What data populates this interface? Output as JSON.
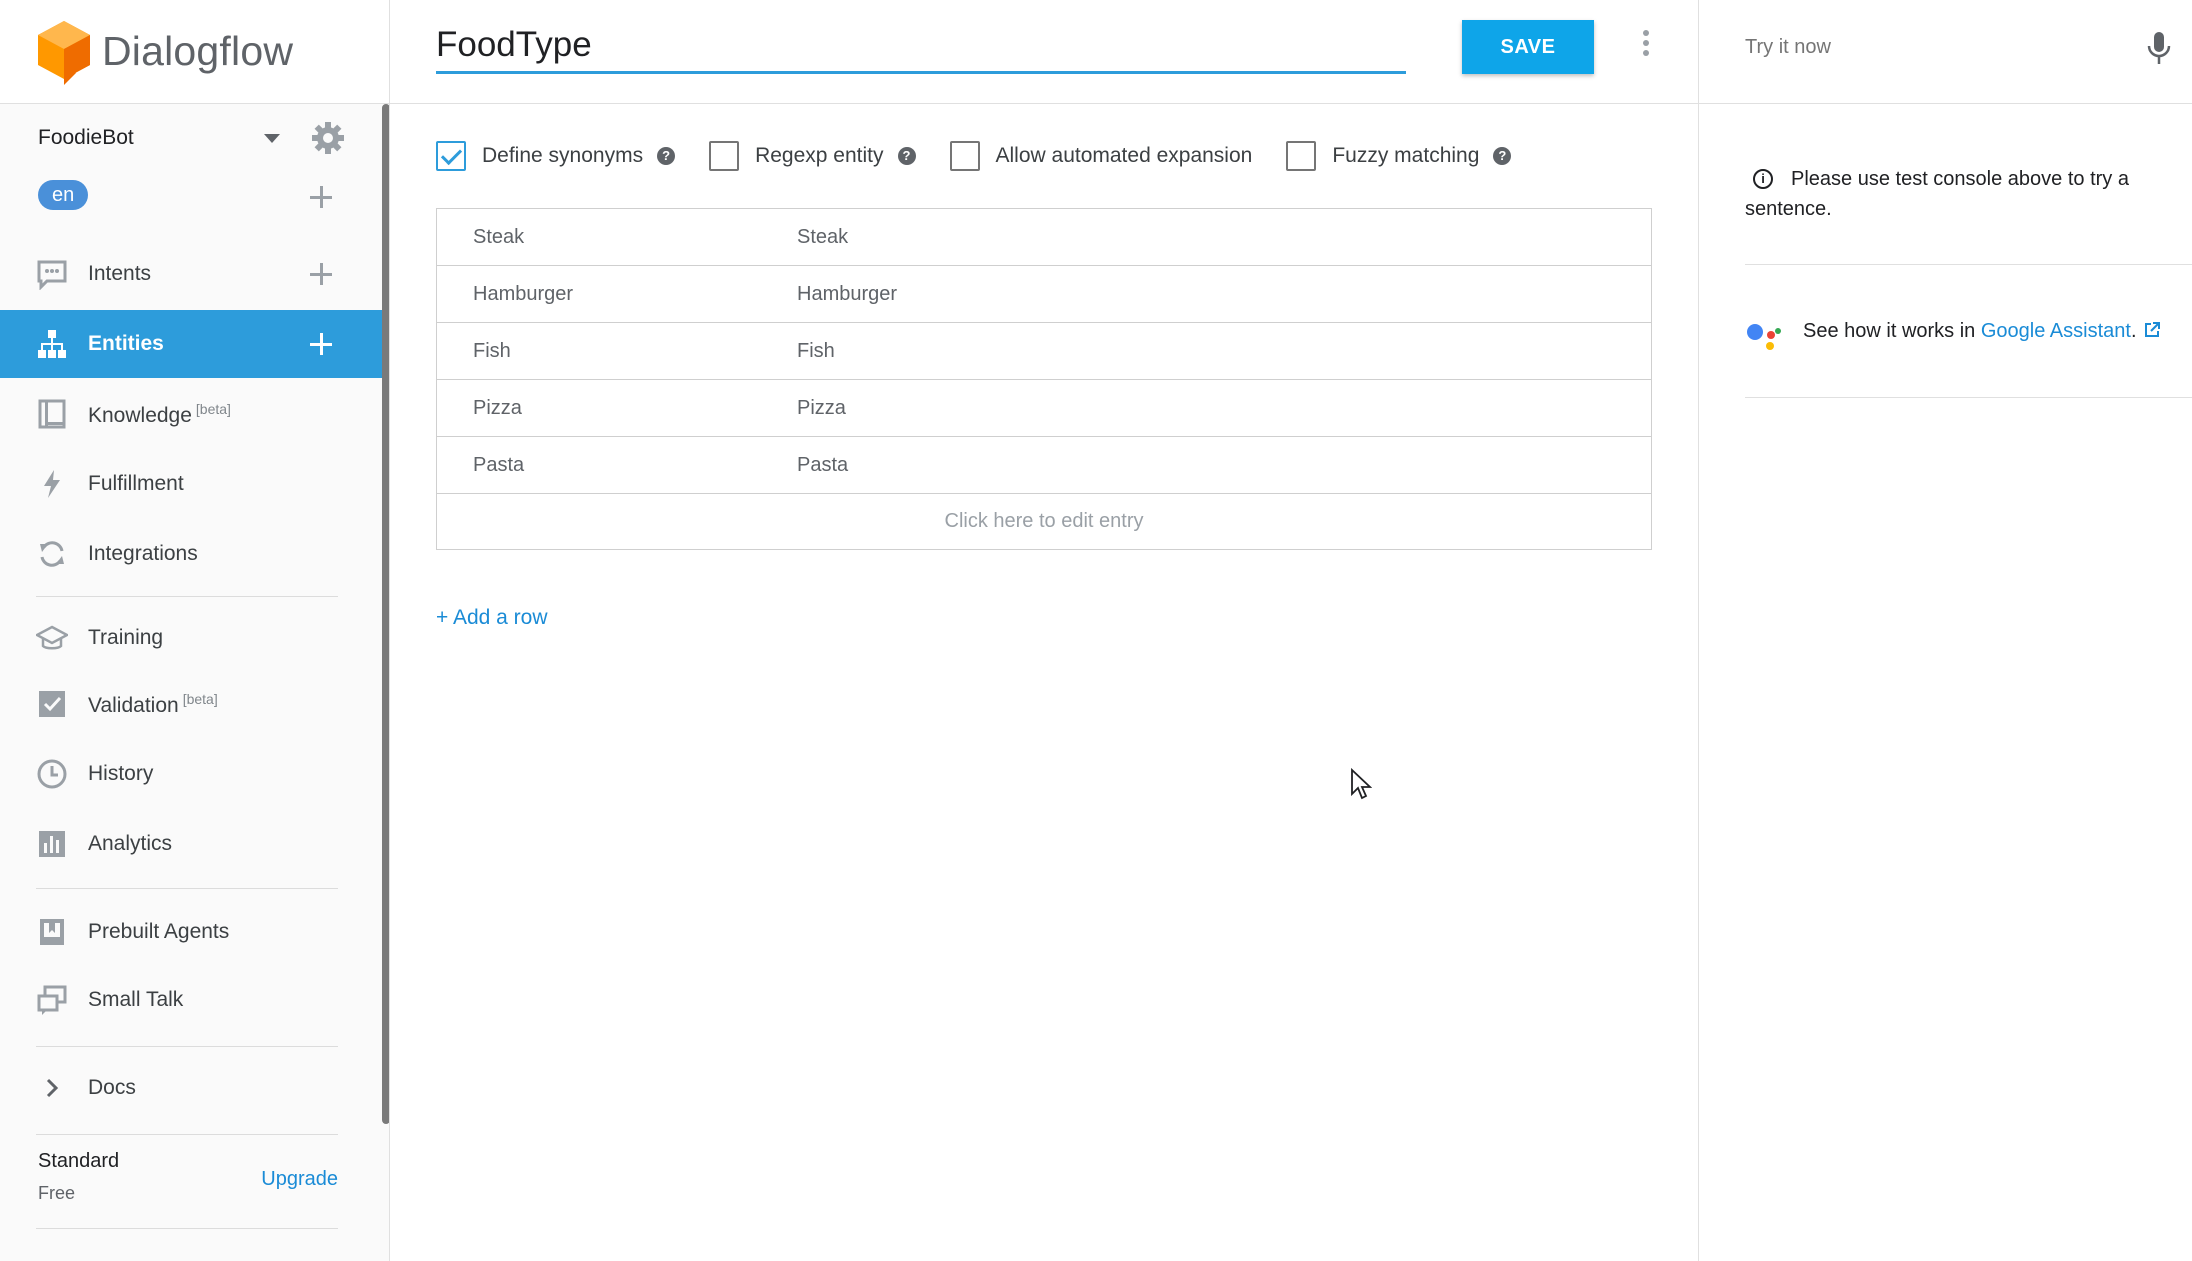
{
  "app": {
    "name": "Dialogflow"
  },
  "agent": {
    "name": "FoodieBot",
    "language": "en"
  },
  "nav": {
    "intents": "Intents",
    "entities": "Entities",
    "knowledge": "Knowledge",
    "knowledge_badge": "[beta]",
    "fulfillment": "Fulfillment",
    "integrations": "Integrations",
    "training": "Training",
    "validation": "Validation",
    "validation_badge": "[beta]",
    "history": "History",
    "analytics": "Analytics",
    "prebuilt_agents": "Prebuilt Agents",
    "small_talk": "Small Talk",
    "docs": "Docs"
  },
  "plan": {
    "name": "Standard",
    "tier": "Free",
    "upgrade": "Upgrade"
  },
  "entity": {
    "name": "FoodType",
    "save": "SAVE",
    "options": {
      "define_synonyms": {
        "label": "Define synonyms",
        "checked": true
      },
      "regexp_entity": {
        "label": "Regexp entity",
        "checked": false
      },
      "automated_expansion": {
        "label": "Allow automated expansion",
        "checked": false
      },
      "fuzzy_matching": {
        "label": "Fuzzy matching",
        "checked": false
      }
    },
    "entries": [
      {
        "reference": "Steak",
        "synonyms": "Steak"
      },
      {
        "reference": "Hamburger",
        "synonyms": "Hamburger"
      },
      {
        "reference": "Fish",
        "synonyms": "Fish"
      },
      {
        "reference": "Pizza",
        "synonyms": "Pizza"
      },
      {
        "reference": "Pasta",
        "synonyms": "Pasta"
      }
    ],
    "edit_placeholder": "Click here to edit entry",
    "add_row": "+ Add a row"
  },
  "console": {
    "try_placeholder": "Try it now",
    "info": "Please use test console above to try a sentence.",
    "ga_prefix": "See how it works in",
    "ga_link": "Google Assistant",
    "ga_suffix": "."
  },
  "colors": {
    "accent": "#2d9cdb",
    "save": "#0ea5e9",
    "link": "#1a8bd6",
    "logo": "#f57c00"
  }
}
